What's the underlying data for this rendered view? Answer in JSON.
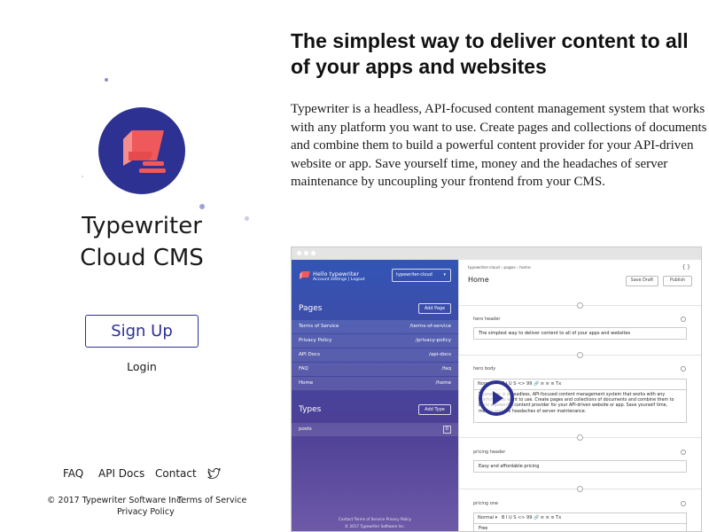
{
  "brand": {
    "name": "Typewriter Cloud CMS"
  },
  "actions": {
    "signup": "Sign Up",
    "login": "Login"
  },
  "footer": {
    "links": [
      "FAQ",
      "API Docs",
      "Contact"
    ],
    "twitter_icon": "twitter-bird-icon",
    "copyright": "© 2017 Typewriter Software Inc.",
    "terms": "Terms of Service",
    "privacy": "Privacy Policy"
  },
  "hero": {
    "title": "The simplest way to deliver content to all of your apps and websites",
    "body": "Typewriter is a headless, API-focused content management system that works with any platform you want to use. Create pages and collections of documents and combine them to build a powerful content provider for your API-driven website or app. Save yourself time, money and the headaches of server maintenance by uncoupling your frontend from your CMS."
  },
  "colors": {
    "brand": "#2d3192",
    "logo_accent": "#f0595b",
    "sidebar_top": "#3355b5",
    "sidebar_bottom": "#6e5aa8"
  },
  "app": {
    "greeting": "Hello typewriter",
    "account_links": "Account settings | Logout",
    "workspace": "typewriter-cloud",
    "pages_title": "Pages",
    "add_page": "Add Page",
    "pages": [
      {
        "name": "Terms of Service",
        "path": "/terms-of-service"
      },
      {
        "name": "Privacy Policy",
        "path": "/privacy-policy"
      },
      {
        "name": "API Docs",
        "path": "/api-docs"
      },
      {
        "name": "FAQ",
        "path": "/faq"
      },
      {
        "name": "Home",
        "path": "/home"
      }
    ],
    "types_title": "Types",
    "add_type": "Add Type",
    "types": [
      {
        "name": "posts",
        "count": "0"
      }
    ],
    "sidebar_footer": "Contact  Terms of Service  Privacy Policy",
    "sidebar_copyright": "© 2017 Typewriter Software Inc.",
    "breadcrumb": "typewriter-cloud › pages › home",
    "page_title": "Home",
    "code_toggle": "{ }",
    "save_draft": "Save Draft",
    "publish": "Publish",
    "editor_format": "Normal",
    "editor_tools": "B  I  U  S  <>  99  🔗   ≡  ≡  ≡   Tx",
    "fields": [
      {
        "label": "hero header",
        "value": "The simplest way to deliver content to all of your apps and websites"
      },
      {
        "label": "hero body",
        "value": "Typewriter is a headless, API-focused content management system that works with any platform you want to use. Create pages and collections of documents and combine them to build a powerful content provider for your API-driven website or app. Save yourself time, money and the headaches of server maintenance."
      },
      {
        "label": "pricing header",
        "value": "Easy and affordable pricing"
      },
      {
        "label": "pricing one",
        "value": "Free"
      }
    ]
  }
}
